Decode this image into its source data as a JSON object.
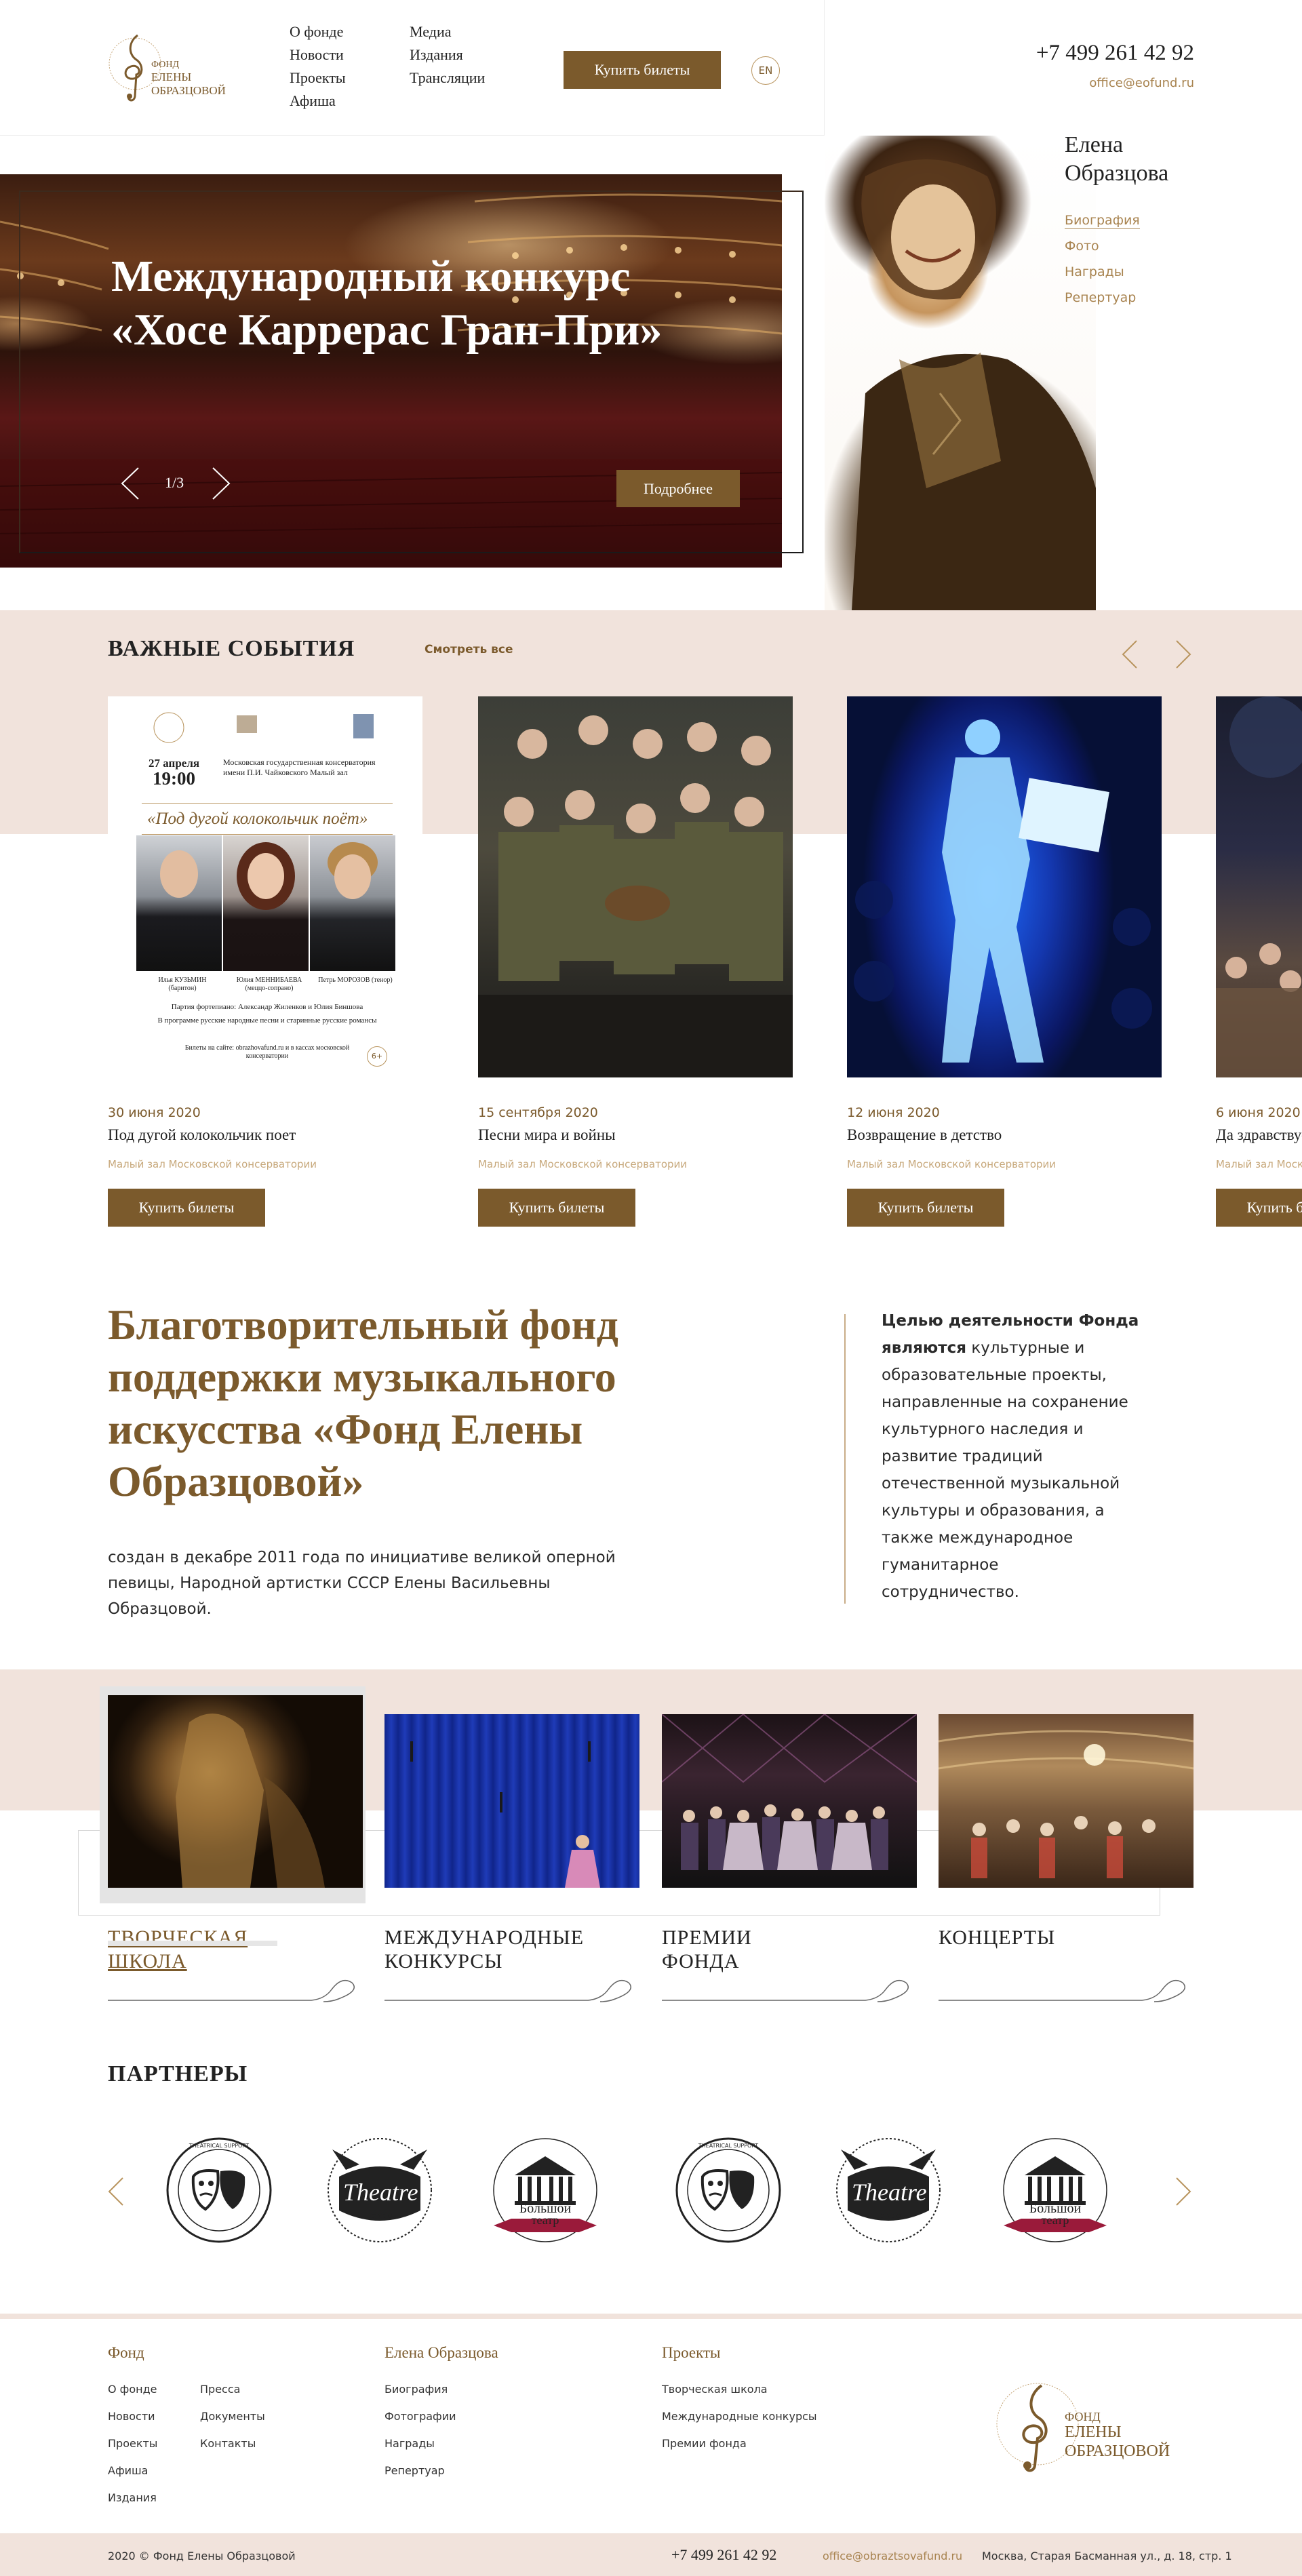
{
  "header": {
    "logo": {
      "line1": "ФОНД",
      "line2": "ЕЛЕНЫ",
      "line3": "ОБРАЗЦОВОЙ"
    },
    "nav_col1": [
      "О фонде",
      "Новости",
      "Проекты",
      "Афиша"
    ],
    "nav_col2": [
      "Медиа",
      "Издания",
      "Трансляции"
    ],
    "buy_label": "Купить билеты",
    "lang": "EN",
    "phone": "+7 499 261 42 92",
    "email": "office@eofund.ru"
  },
  "hero": {
    "title": "Международный конкурс «Хосе Каррерас Гран-При»",
    "counter": "1/3",
    "more_label": "Подробнее"
  },
  "portrait": {
    "name_line1": "Елена",
    "name_line2": "Образцова",
    "links": [
      "Биография",
      "Фото",
      "Награды",
      "Репертуар"
    ]
  },
  "events": {
    "title": "ВАЖНЫЕ СОБЫТИЯ",
    "see_all": "Смотреть все",
    "items": [
      {
        "date": "30 июня 2020",
        "name": "Под дугой колокольчик поет",
        "place": "Малый зал Московской консерватории",
        "button": "Купить билеты"
      },
      {
        "date": "15 сентября 2020",
        "name": "Песни мира и войны",
        "place": "Малый зал Московской консерватории",
        "button": "Купить билеты"
      },
      {
        "date": "12 июня 2020",
        "name": "Возвращение в детство",
        "place": "Малый зал Московской консерватории",
        "button": "Купить билеты"
      },
      {
        "date": "6 июня 2020",
        "name": "Да здравствует",
        "place": "Малый зал Московской консерватории",
        "button": "Купить билеты"
      }
    ],
    "poster": {
      "date": "27 апреля",
      "time": "19:00",
      "venue": "Московская государственная консерватория имени П.И. Чайковского Малый зал",
      "title": "«Под дугой колокольчик поёт»",
      "artists": [
        "Илья КУЗЬМИН (баритон)",
        "Юлия МЕННИБАЕВА (меццо-сопрано)",
        "Петрь МОРОЗОВ (тенор)"
      ],
      "accompany": "Партия фортепиано: Александр Жиленков и Юлия Биншова",
      "program": "В программе русские народные песни и старинные русские романсы",
      "tickets": "Билеты на сайте: obrazhovafund.ru и в кассах московской консерватории",
      "age": "6+"
    }
  },
  "about": {
    "title": "Благотворительный фонд поддержки музыкального искусства «Фонд Елены Образцовой»",
    "subtitle": "создан в декабре 2011 года по инициативе великой оперной певицы, Народной артистки СССР Елены Васильевны Образцовой.",
    "aside_bold": "Целью деятельности Фонда являются",
    "aside_rest": " культурные и образовательные проекты, направленные на сохранение культурного наследия и развитие традиций отечественной музыкальной культуры и образования, а также международное гуманитарное сотрудничество."
  },
  "directions": [
    {
      "line1": "ТВОРЧЕСКАЯ",
      "line2": "ШКОЛА"
    },
    {
      "line1": "МЕЖДУНАРОДНЫЕ",
      "line2": "КОНКУРСЫ"
    },
    {
      "line1": "ПРЕМИИ",
      "line2": "ФОНДА"
    },
    {
      "line1": "КОНЦЕРТЫ",
      "line2": ""
    }
  ],
  "partners": {
    "title": "ПАРТНЕРЫ",
    "logos": [
      {
        "kind": "masks",
        "text": "THEATRICAL SUPPORT"
      },
      {
        "kind": "theatre",
        "text": "Theatre",
        "sub": "LONDON"
      },
      {
        "kind": "bolshoi",
        "text1": "Большой",
        "text2": "театр"
      },
      {
        "kind": "masks",
        "text": "THEATRICAL SUPPORT"
      },
      {
        "kind": "theatre",
        "text": "Theatre",
        "sub": "LONDON"
      },
      {
        "kind": "bolshoi",
        "text1": "Большой",
        "text2": "театр"
      }
    ]
  },
  "footer": {
    "col1_title": "Фонд",
    "col1_a": [
      "О фонде",
      "Новости",
      "Проекты",
      "Афиша",
      "Издания"
    ],
    "col1_b": [
      "Пресса",
      "Документы",
      "Контакты"
    ],
    "col2_title": "Елена Образцова",
    "col2": [
      "Биография",
      "Фотографии",
      "Награды",
      "Репертуар"
    ],
    "col3_title": "Проекты",
    "col3": [
      "Творческая школа",
      "Международные конкурсы",
      "Премии фонда"
    ],
    "logo": {
      "line1": "ФОНД",
      "line2": "ЕЛЕНЫ",
      "line3": "ОБРАЗЦОВОЙ"
    },
    "copyright": "2020 © Фонд Елены Образцовой",
    "phone": "+7 499 261 42 92",
    "email": "office@obraztsovafund.ru",
    "address": "Москва, Старая Басманная ул., д. 18, стр. 1"
  },
  "colors": {
    "accent": "#7b5a2c",
    "band": "#f1e3dc",
    "light_accent": "#a8834f"
  }
}
